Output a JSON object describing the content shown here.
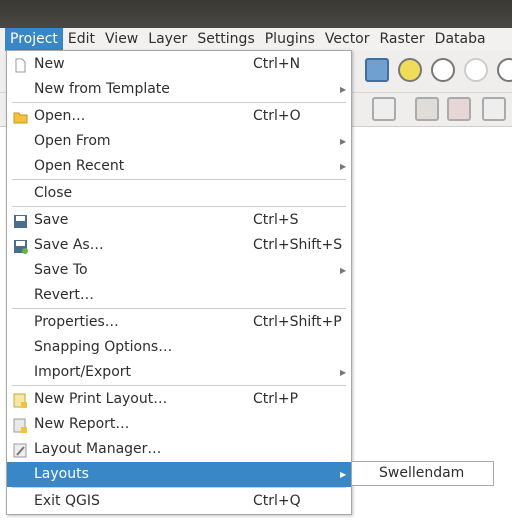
{
  "menubar": [
    "Project",
    "Edit",
    "View",
    "Layer",
    "Settings",
    "Plugins",
    "Vector",
    "Raster",
    "Databa"
  ],
  "menu": {
    "items": [
      {
        "label": "New",
        "shortcut": "Ctrl+N",
        "icon": "new-file-icon"
      },
      {
        "label": "New from Template",
        "submenu": true
      },
      {
        "label": "Open…",
        "shortcut": "Ctrl+O",
        "icon": "folder-icon"
      },
      {
        "label": "Open From",
        "submenu": true
      },
      {
        "label": "Open Recent",
        "submenu": true
      },
      {
        "label": "Close"
      },
      {
        "label": "Save",
        "shortcut": "Ctrl+S",
        "icon": "save-icon"
      },
      {
        "label": "Save As…",
        "shortcut": "Ctrl+Shift+S",
        "icon": "save-as-icon"
      },
      {
        "label": "Save To",
        "submenu": true
      },
      {
        "label": "Revert…"
      },
      {
        "label": "Properties…",
        "shortcut": "Ctrl+Shift+P"
      },
      {
        "label": "Snapping Options…"
      },
      {
        "label": "Import/Export",
        "submenu": true
      },
      {
        "label": "New Print Layout…",
        "shortcut": "Ctrl+P",
        "icon": "new-print-layout-icon"
      },
      {
        "label": "New Report…",
        "icon": "new-report-icon"
      },
      {
        "label": "Layout Manager…",
        "icon": "layout-manager-icon"
      },
      {
        "label": "Layouts",
        "submenu": true,
        "highlighted": true
      },
      {
        "label": "Exit QGIS",
        "shortcut": "Ctrl+Q"
      }
    ]
  },
  "submenu": {
    "items": [
      "Swellendam"
    ]
  },
  "colors": {
    "highlight": "#3a87c8"
  }
}
